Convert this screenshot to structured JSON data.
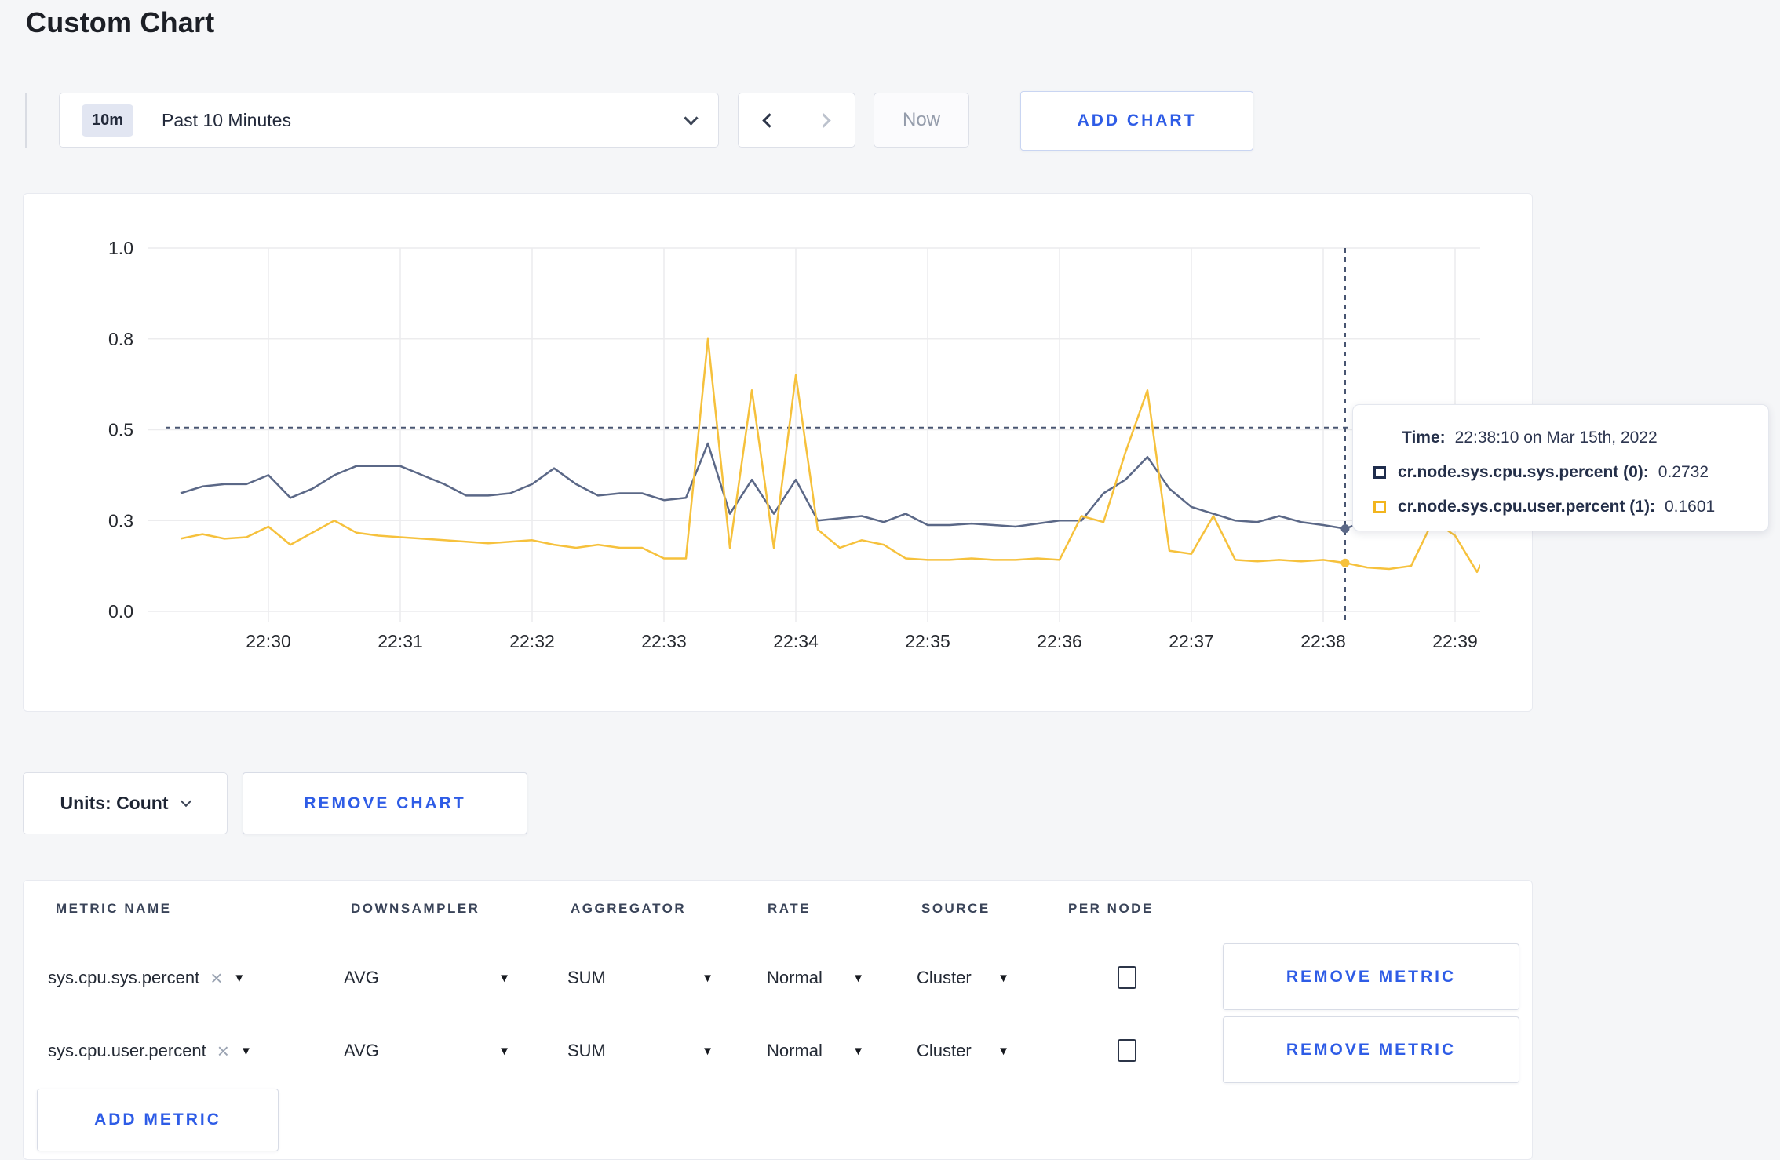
{
  "page": {
    "title": "Custom Chart"
  },
  "toolbar": {
    "range_badge": "10m",
    "range_label": "Past 10 Minutes",
    "now_label": "Now",
    "add_chart_label": "ADD CHART"
  },
  "icons": {
    "caret_down": "▼",
    "close": "×"
  },
  "chart_data": {
    "type": "line",
    "title": "",
    "xlabel": "",
    "ylabel": "",
    "grid": true,
    "grid_color": "#ececee",
    "x_axis": {
      "ticks": [
        "22:30",
        "22:31",
        "22:32",
        "22:33",
        "22:34",
        "22:35",
        "22:36",
        "22:37",
        "22:38",
        "22:39"
      ]
    },
    "y_axis": {
      "ticks": [
        "0.0",
        "0.3",
        "0.5",
        "0.8",
        "1.0"
      ],
      "spacing": "even",
      "ylim": [
        0.0,
        1.0
      ]
    },
    "times": [
      "22:29:20",
      "22:29:30",
      "22:29:40",
      "22:29:50",
      "22:30:00",
      "22:30:10",
      "22:30:20",
      "22:30:30",
      "22:30:40",
      "22:30:50",
      "22:31:00",
      "22:31:10",
      "22:31:20",
      "22:31:30",
      "22:31:40",
      "22:31:50",
      "22:32:00",
      "22:32:10",
      "22:32:20",
      "22:32:30",
      "22:32:40",
      "22:32:50",
      "22:33:00",
      "22:33:10",
      "22:33:20",
      "22:33:30",
      "22:33:40",
      "22:33:50",
      "22:34:00",
      "22:34:10",
      "22:34:20",
      "22:34:30",
      "22:34:40",
      "22:34:50",
      "22:35:00",
      "22:35:10",
      "22:35:20",
      "22:35:30",
      "22:35:40",
      "22:35:50",
      "22:36:00",
      "22:36:10",
      "22:36:20",
      "22:36:30",
      "22:36:40",
      "22:36:50",
      "22:37:00",
      "22:37:10",
      "22:37:20",
      "22:37:30",
      "22:37:40",
      "22:37:50",
      "22:38:00",
      "22:38:10",
      "22:38:20",
      "22:38:30",
      "22:38:40",
      "22:38:50",
      "22:39:00",
      "22:39:10",
      "22:39:20"
    ],
    "series": [
      {
        "name": "cr.node.sys.cpu.sys.percent (0)",
        "color": "#5b6887",
        "values": [
          0.36,
          0.375,
          0.38,
          0.38,
          0.4,
          0.35,
          0.37,
          0.4,
          0.42,
          0.42,
          0.42,
          0.4,
          0.38,
          0.355,
          0.355,
          0.36,
          0.38,
          0.415,
          0.38,
          0.355,
          0.36,
          0.36,
          0.345,
          0.35,
          0.47,
          0.315,
          0.39,
          0.315,
          0.39,
          0.3,
          0.305,
          0.31,
          0.295,
          0.315,
          0.285,
          0.285,
          0.29,
          0.285,
          0.28,
          0.29,
          0.3,
          0.3,
          0.36,
          0.39,
          0.44,
          0.37,
          0.33,
          0.315,
          0.3,
          0.295,
          0.31,
          0.295,
          0.285,
          0.2732,
          0.3,
          0.3,
          0.31,
          0.32,
          0.3,
          0.295,
          0.315
        ]
      },
      {
        "name": "cr.node.sys.cpu.user.percent (1)",
        "color": "#f6c13c",
        "values": [
          0.24,
          0.255,
          0.24,
          0.245,
          0.28,
          0.22,
          0.26,
          0.3,
          0.26,
          0.25,
          0.245,
          0.24,
          0.235,
          0.23,
          0.225,
          0.23,
          0.235,
          0.22,
          0.21,
          0.22,
          0.21,
          0.21,
          0.175,
          0.175,
          0.8,
          0.21,
          0.63,
          0.21,
          0.68,
          0.27,
          0.21,
          0.235,
          0.22,
          0.175,
          0.17,
          0.17,
          0.175,
          0.17,
          0.17,
          0.175,
          0.17,
          0.31,
          0.295,
          0.45,
          0.63,
          0.2,
          0.19,
          0.31,
          0.17,
          0.165,
          0.17,
          0.165,
          0.17,
          0.1601,
          0.145,
          0.14,
          0.15,
          0.3,
          0.25,
          0.13,
          0.27
        ]
      }
    ],
    "crosshair": {
      "time": "22:38:10",
      "hline_value": 0.507,
      "color": "#485571",
      "hover_points": [
        {
          "series": 0,
          "value": 0.2732
        },
        {
          "series": 1,
          "value": 0.1601
        }
      ]
    }
  },
  "tooltip": {
    "time_label": "Time:",
    "time_value": "22:38:10 on Mar 15th, 2022",
    "rows": [
      {
        "label": "cr.node.sys.cpu.sys.percent (0):",
        "value": "0.2732",
        "color": "#1f2d4d"
      },
      {
        "label": "cr.node.sys.cpu.user.percent (1):",
        "value": "0.1601",
        "color": "#f2b51e"
      }
    ]
  },
  "chart_actions": {
    "units_label": "Units: Count",
    "remove_chart_label": "REMOVE CHART"
  },
  "metrics_table": {
    "headers": [
      "METRIC NAME",
      "DOWNSAMPLER",
      "AGGREGATOR",
      "RATE",
      "SOURCE",
      "PER NODE"
    ],
    "remove_metric_label": "REMOVE METRIC",
    "add_metric_label": "ADD METRIC",
    "rows": [
      {
        "name": "sys.cpu.sys.percent",
        "downsampler": "AVG",
        "aggregator": "SUM",
        "rate": "Normal",
        "source": "Cluster",
        "per_node_checked": false
      },
      {
        "name": "sys.cpu.user.percent",
        "downsampler": "AVG",
        "aggregator": "SUM",
        "rate": "Normal",
        "source": "Cluster",
        "per_node_checked": false
      }
    ]
  }
}
